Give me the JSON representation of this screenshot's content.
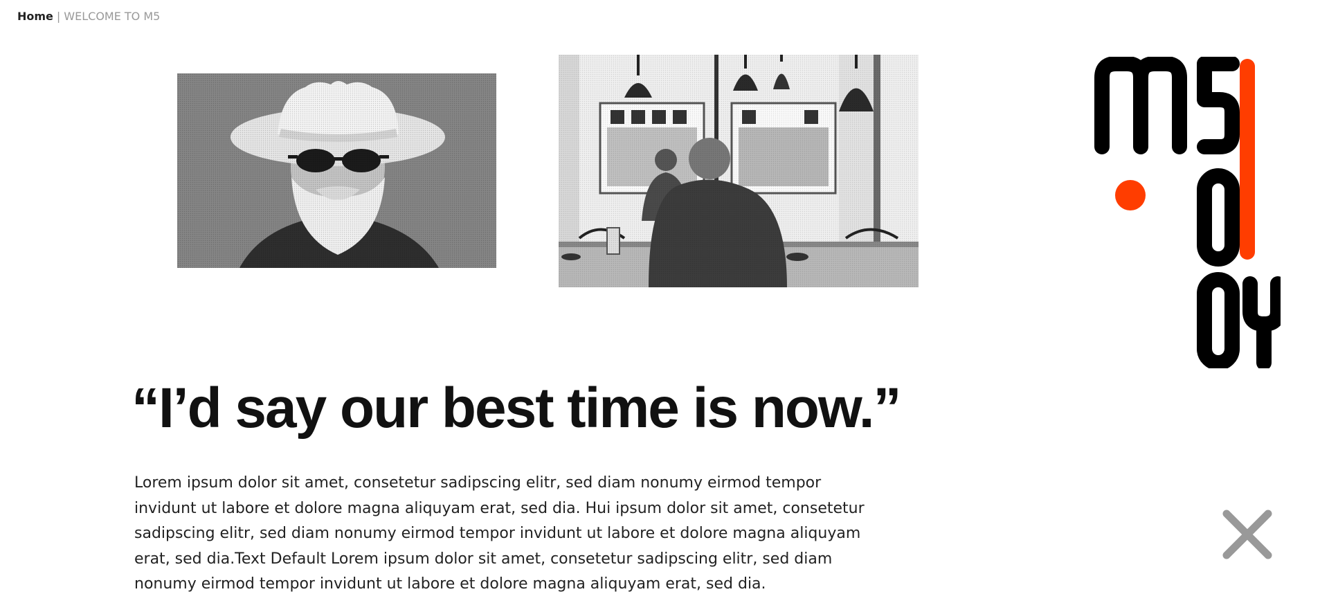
{
  "breadcrumb": {
    "home_label": "Home",
    "separator": "|",
    "current_label": "WELCOME TO M5"
  },
  "photos": [
    {
      "icon": "portrait-man-cowboy-hat-photo"
    },
    {
      "icon": "cafe-interior-photo"
    }
  ],
  "logo": {
    "icon": "m5-logo",
    "accent_color": "#ff3d00",
    "ink_color": "#000000"
  },
  "quote": {
    "text": "“I’d say our best time is now.”"
  },
  "body": {
    "text": "Lorem ipsum dolor sit amet, consetetur sadipscing elitr, sed diam nonumy eirmod tempor invidunt ut labore et dolore magna aliquyam erat, sed dia. Hui ipsum dolor sit amet, consetetur sadipscing elitr, sed diam nonumy eirmod tempor invidunt ut labore et dolore magna aliquyam erat, sed dia.Text Default Lorem ipsum dolor sit amet, consetetur sadipscing elitr, sed diam nonumy eirmod tempor invidunt ut labore et dolore magna aliquyam erat, sed dia."
  },
  "close": {
    "icon": "close-icon",
    "color": "#999999"
  }
}
